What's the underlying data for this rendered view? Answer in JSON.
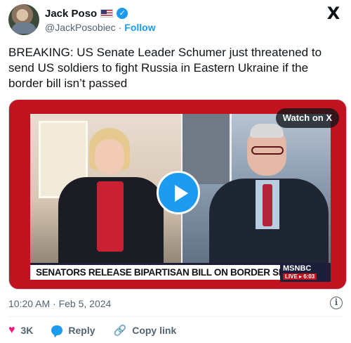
{
  "author": {
    "name": "Jack Poso",
    "handle": "@JackPosobiec",
    "separator": "·",
    "follow_label": "Follow",
    "flag_icon": "us-flag-icon",
    "verified_icon": "verified-badge-icon",
    "verified_glyph": "✓"
  },
  "platform": {
    "logo_glyph": "X",
    "logo_icon": "x-logo-icon"
  },
  "tweet": {
    "text": "BREAKING: US Senate Leader Schumer just threatened to send US soldiers to fight Russia in Eastern Ukraine if the border bill isn’t passed",
    "timestamp": "10:20 AM · Feb 5, 2024",
    "info_glyph": "i"
  },
  "media": {
    "watch_label": "Watch on X",
    "chyron_text": "SENATORS RELEASE BIPARTISAN BILL ON BORDER SECURITY",
    "network": "MSNBC",
    "live_text": "LIVE ▸ 6:03",
    "play_icon": "play-icon"
  },
  "actions": {
    "like_glyph": "♥",
    "like_count": "3K",
    "reply_label": "Reply",
    "copy_label": "Copy link",
    "link_glyph": "🔗"
  },
  "colors": {
    "accent": "#1d9bf0",
    "like": "#f91880",
    "text": "#0f1419",
    "muted": "#536471",
    "broadcast_red": "#c1121f"
  }
}
